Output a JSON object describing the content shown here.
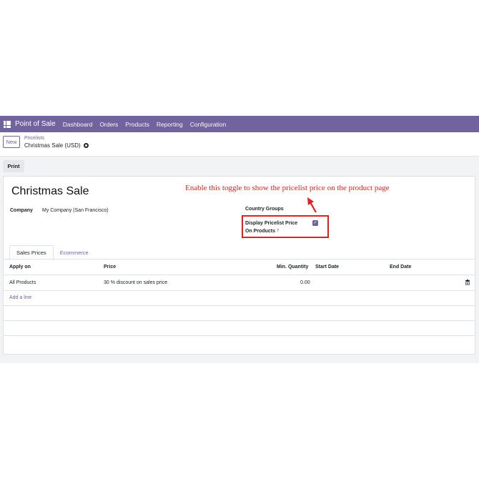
{
  "topnav": {
    "brand": "Point of Sale",
    "items": [
      "Dashboard",
      "Orders",
      "Products",
      "Reporting",
      "Configuration"
    ]
  },
  "control_panel": {
    "new_label": "New",
    "breadcrumb_parent": "Pricelists",
    "breadcrumb_current": "Christmas Sale (USD)"
  },
  "actions": {
    "print_label": "Print"
  },
  "record": {
    "title": "Christmas Sale",
    "company_label": "Company",
    "company_value": "My Company (San Francisco)",
    "country_groups_label": "Country Groups",
    "display_pricelist_label_1": "Display Pricelist Price",
    "display_pricelist_label_2": "On Products",
    "tooltip_mark": "?",
    "display_pricelist_checked": true
  },
  "annotation": {
    "text": "Enable this toggle to show the pricelist price on the product page",
    "color": "#e02020"
  },
  "tabs": [
    "Sales Prices",
    "Ecommerce"
  ],
  "table": {
    "headers": {
      "apply_on": "Apply on",
      "price": "Price",
      "min_qty": "Min. Quantity",
      "start_date": "Start Date",
      "end_date": "End Date"
    },
    "rows": [
      {
        "apply_on": "All Products",
        "price": "30 % discount on sales price",
        "min_qty": "0.00",
        "start_date": "",
        "end_date": ""
      }
    ],
    "add_line": "Add a line"
  },
  "colors": {
    "brand": "#71639e",
    "highlight": "#e02020"
  }
}
